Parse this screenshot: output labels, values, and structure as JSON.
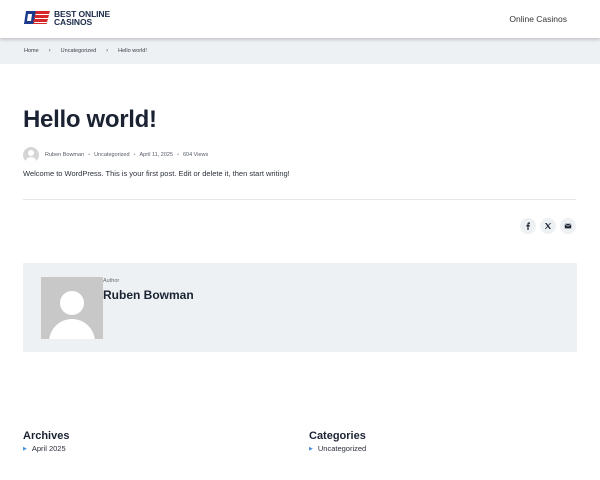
{
  "header": {
    "logo_line1": "BEST ONLINE",
    "logo_line2": "CASINOS",
    "nav_link": "Online Casinos"
  },
  "breadcrumb": {
    "items": [
      "Home",
      "Uncategorized",
      "Hello world!"
    ]
  },
  "post": {
    "title": "Hello world!",
    "author": "Ruben Bowman",
    "category": "Uncategorized",
    "date": "April 11, 2025",
    "views": "604 Views",
    "content": "Welcome to WordPress. This is your first post. Edit or delete it, then start writing!"
  },
  "share": {
    "icons": [
      "facebook-icon",
      "x-icon",
      "email-icon"
    ]
  },
  "author_box": {
    "label": "Author",
    "name": "Ruben Bowman"
  },
  "widgets": {
    "archives": {
      "title": "Archives",
      "items": [
        "April 2025"
      ]
    },
    "categories": {
      "title": "Categories",
      "items": [
        "Uncategorized"
      ]
    }
  },
  "colors": {
    "accent": "#4a90d9",
    "panel_bg": "#eef1f4",
    "heading": "#1b2333"
  }
}
